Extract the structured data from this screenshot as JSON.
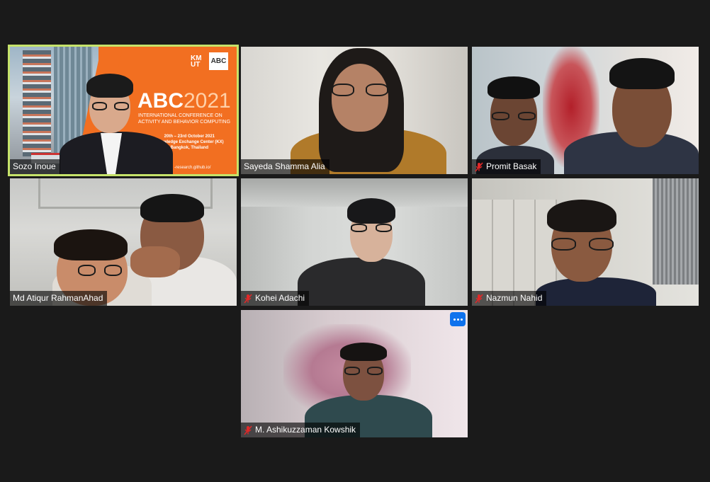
{
  "participants": [
    {
      "name": "Sozo Inoue",
      "muted": false,
      "active_speaker": true
    },
    {
      "name": "Sayeda Shamma Alia",
      "muted": false,
      "active_speaker": false
    },
    {
      "name": "Promit Basak",
      "muted": true,
      "active_speaker": false
    },
    {
      "name": "Md Atiqur RahmanAhad",
      "muted": false,
      "active_speaker": false
    },
    {
      "name": "Kohei Adachi",
      "muted": true,
      "active_speaker": false
    },
    {
      "name": "Nazmun Nahid",
      "muted": true,
      "active_speaker": false
    },
    {
      "name": "M. Ashikuzzaman Kowshik",
      "muted": true,
      "active_speaker": false
    }
  ],
  "slide": {
    "logo_left": "KM\nUT",
    "logo_right": "ABC",
    "title_main": "ABC",
    "title_year": "2021",
    "subtitle_line1": "INTERNATIONAL CONFERENCE ON",
    "subtitle_line2": "ACTIVITY AND BEHAVIOR COMPUTING",
    "info_line1": "20th – 23rd October 2021",
    "info_line2": "Knowledge Exchange Center (KX)",
    "info_line3": "Bangkok, Thailand",
    "url": "-research.github.io/"
  },
  "icons": {
    "muted_mic": "muted-microphone-icon",
    "more": "more-options-icon"
  },
  "colors": {
    "background": "#1a1a1a",
    "active_speaker_border": "#c6e36a",
    "muted_icon": "#e02828",
    "more_button": "#0e72ed",
    "slide_orange": "#f26f21"
  }
}
